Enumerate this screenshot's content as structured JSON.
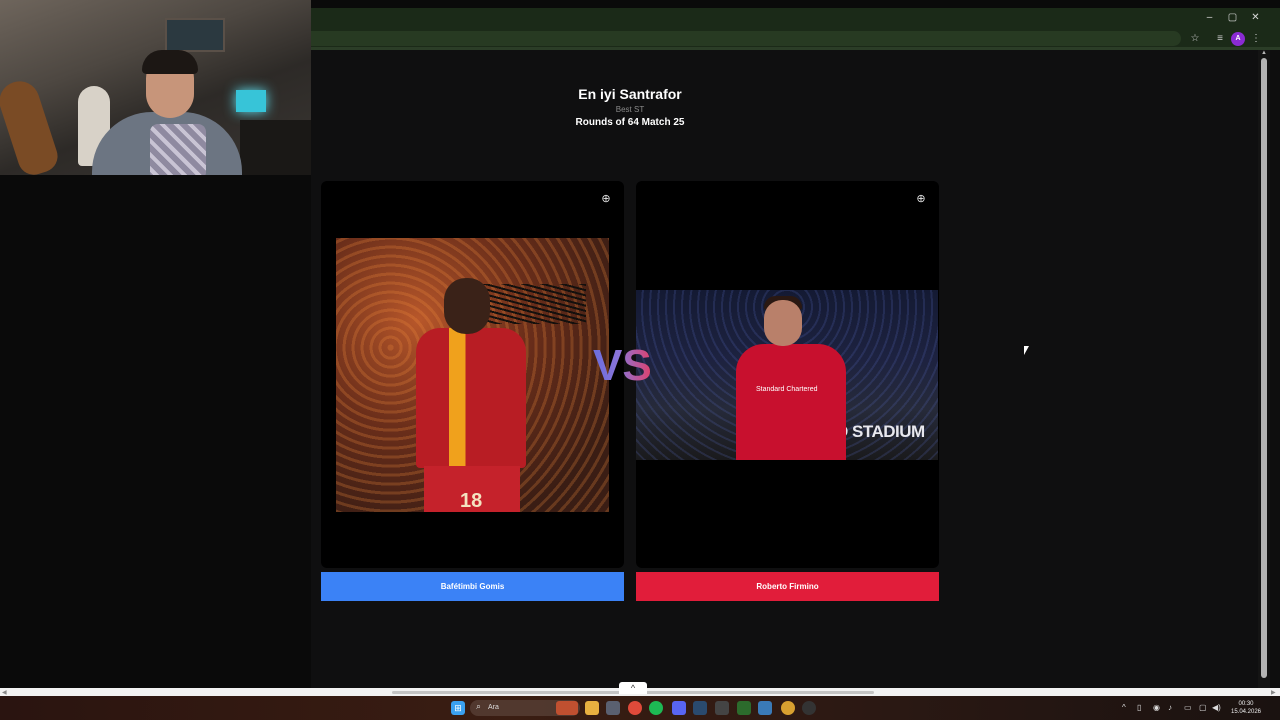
{
  "browser": {
    "minimize": "–",
    "maximize": "▢",
    "close": "✕",
    "bookmark_icon": "☆",
    "extensions_icon": "≡",
    "profile_initial": "A",
    "menu_icon": "⋮"
  },
  "page": {
    "title": "En iyi Santrafor",
    "subtitle": "Best ST",
    "round": "Rounds of 64 Match 25",
    "vs": "VS",
    "zoom_icon": "⊕",
    "left": {
      "name": "Bafétimbi Gomis",
      "jersey_number": "18",
      "button_color": "#3b82f6"
    },
    "right": {
      "name": "Roberto Firmino",
      "sponsor_text": "Standard Chartered",
      "stadium_text": "D STADIUM",
      "button_color": "#e11d3a"
    }
  },
  "taskbar": {
    "search_placeholder": "Ara",
    "search_icon": "⌕",
    "expand_icon": "^",
    "time": "00:30",
    "date": "15.04.2026",
    "apps": [
      "start",
      "files",
      "store",
      "chrome",
      "spotify",
      "discord",
      "steam",
      "editor",
      "media-player",
      "settings",
      "chrome-2",
      "obs"
    ]
  }
}
